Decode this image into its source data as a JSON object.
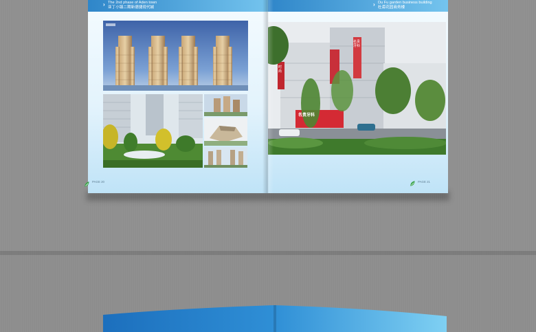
{
  "left_page": {
    "header_en": "The 2nd phase of Aden town",
    "header_cn": "亚丁小镇二期新德捷现代城",
    "page_label": "PAGE 20",
    "badge": "▦"
  },
  "right_page": {
    "header_en": "Du Fu garden business building",
    "header_cn": "杜甫花园商务楼",
    "page_label": "PAGE 21",
    "sign_top": "时尚",
    "sign_mid": "名贵牙科",
    "sign_bottom": "名贵牙科"
  },
  "colors": {
    "header_blue": "#2f86c9",
    "header_light": "#74c4ee",
    "cover_blue": "#1f74c2",
    "logo_green": "#3aa34a"
  }
}
